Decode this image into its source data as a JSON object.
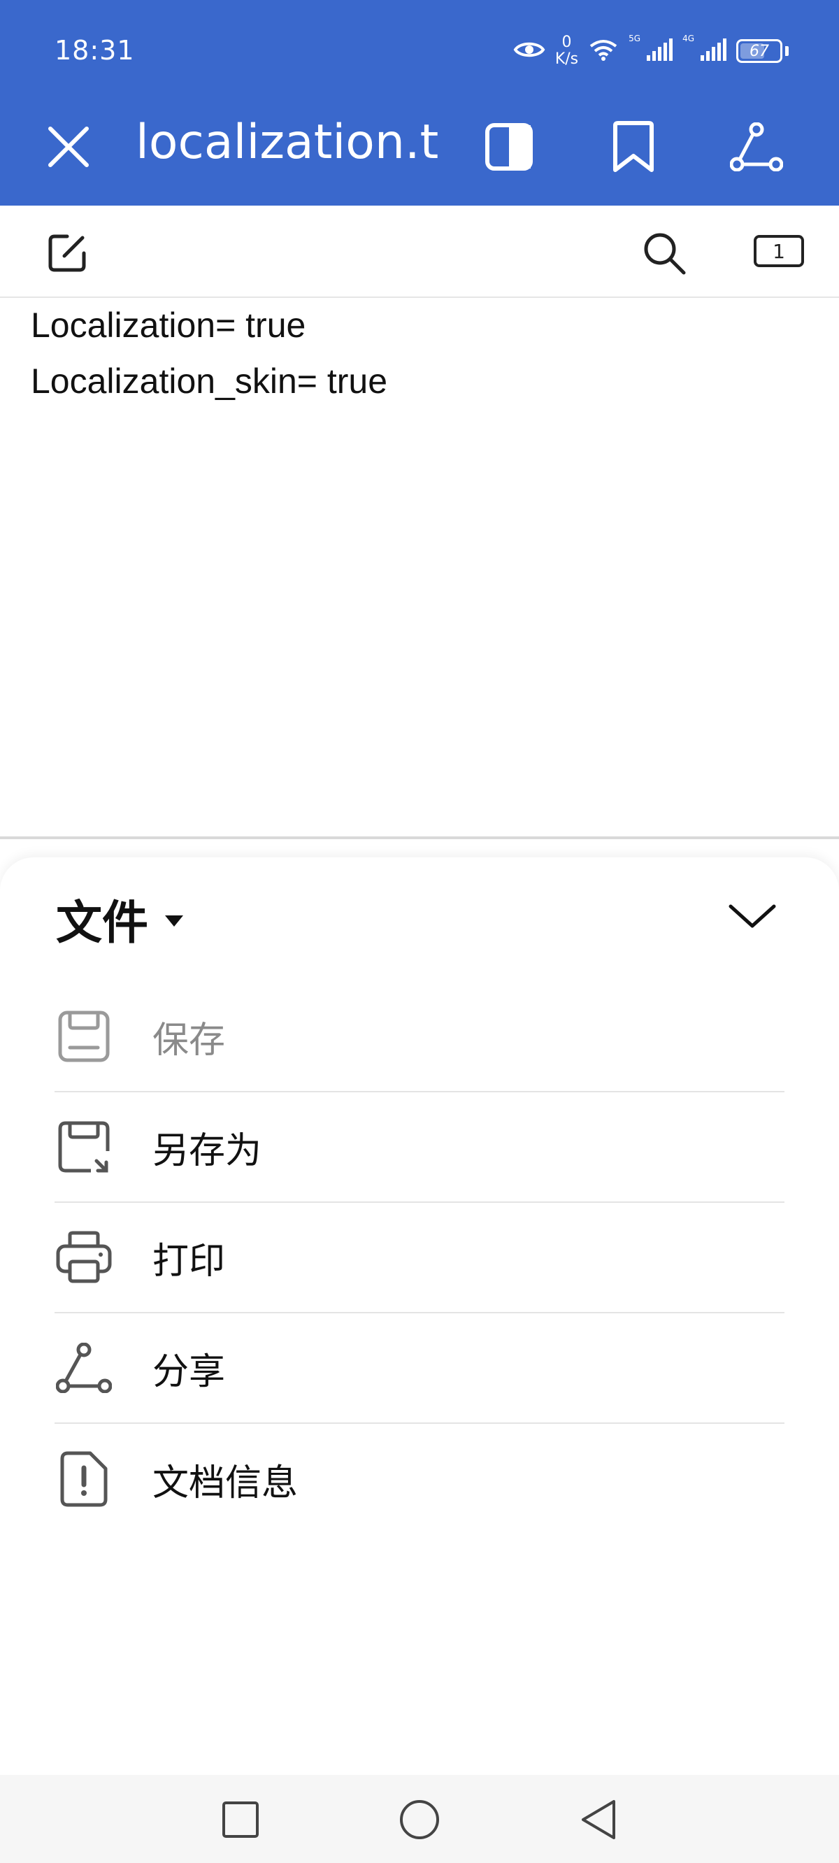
{
  "status_bar": {
    "time": "18:31",
    "net_speed_value": "0",
    "net_speed_unit": "K/s",
    "signal1_label": "5G",
    "signal2_label": "4G",
    "battery": "67",
    "battery_level": 0.67
  },
  "title_bar": {
    "doc_title": "localization.t..",
    "icons": [
      "close-icon",
      "reading-mode-icon",
      "bookmark-icon",
      "share-icon"
    ]
  },
  "edit_toolbar": {
    "page_count": "1",
    "icons": [
      "edit-icon",
      "search-icon"
    ]
  },
  "document": {
    "lines": [
      "Localization= true",
      "Localization_skin= true"
    ]
  },
  "bottom_sheet": {
    "title": "文件",
    "items": [
      {
        "label": "保存",
        "icon": "save-icon",
        "enabled": false
      },
      {
        "label": "另存为",
        "icon": "save-as-icon",
        "enabled": true
      },
      {
        "label": "打印",
        "icon": "print-icon",
        "enabled": true
      },
      {
        "label": "分享",
        "icon": "share-icon",
        "enabled": true
      },
      {
        "label": "文档信息",
        "icon": "document-info-icon",
        "enabled": true
      }
    ]
  },
  "nav_bar": {
    "icons": [
      "recents-square-icon",
      "home-circle-icon",
      "back-triangle-icon"
    ]
  },
  "colors": {
    "accent": "#3a68cc",
    "text": "#111111",
    "disabled_text": "#8a8a8a",
    "divider": "#e4e4e4"
  }
}
